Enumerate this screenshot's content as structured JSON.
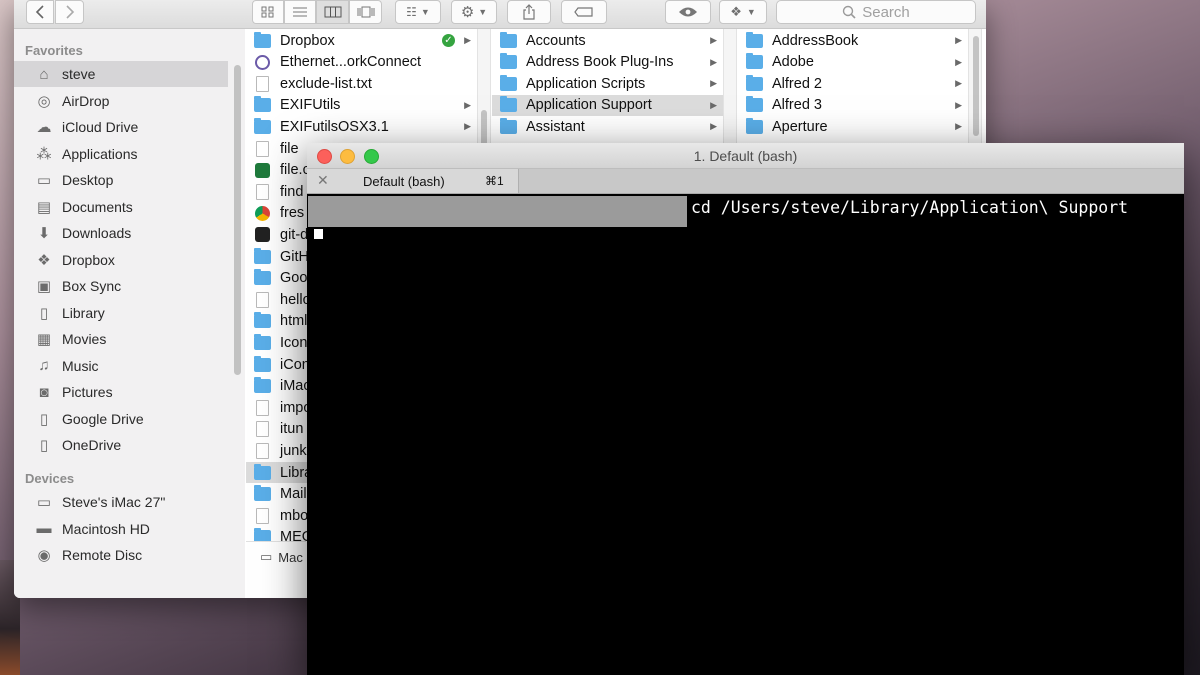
{
  "finder": {
    "search_placeholder": "Search",
    "sidebar": {
      "favorites_label": "Favorites",
      "favorites": [
        {
          "label": "steve",
          "icon": "home-icon",
          "selected": true
        },
        {
          "label": "AirDrop",
          "icon": "airdrop-icon"
        },
        {
          "label": "iCloud Drive",
          "icon": "cloud-icon"
        },
        {
          "label": "Applications",
          "icon": "applications-icon"
        },
        {
          "label": "Desktop",
          "icon": "desktop-icon"
        },
        {
          "label": "Documents",
          "icon": "documents-icon"
        },
        {
          "label": "Downloads",
          "icon": "downloads-icon"
        },
        {
          "label": "Dropbox",
          "icon": "dropbox-icon"
        },
        {
          "label": "Box Sync",
          "icon": "box-icon"
        },
        {
          "label": "Library",
          "icon": "folder-icon"
        },
        {
          "label": "Movies",
          "icon": "movies-icon"
        },
        {
          "label": "Music",
          "icon": "music-icon"
        },
        {
          "label": "Pictures",
          "icon": "camera-icon"
        },
        {
          "label": "Google Drive",
          "icon": "folder-icon"
        },
        {
          "label": "OneDrive",
          "icon": "folder-icon"
        }
      ],
      "devices_label": "Devices",
      "devices": [
        {
          "label": "Steve's iMac 27\"",
          "icon": "imac-icon"
        },
        {
          "label": "Macintosh HD",
          "icon": "harddisk-icon"
        },
        {
          "label": "Remote Disc",
          "icon": "disc-icon"
        }
      ]
    },
    "column1": [
      {
        "label": "Dropbox",
        "kind": "folder",
        "arrow": true
      },
      {
        "label": "Ethernet...orkConnect",
        "kind": "app"
      },
      {
        "label": "exclude-list.txt",
        "kind": "doc"
      },
      {
        "label": "EXIFUtils",
        "kind": "folder",
        "arrow": true
      },
      {
        "label": "EXIFutilsOSX3.1",
        "kind": "folder",
        "arrow": true
      },
      {
        "label": "file",
        "kind": "doc"
      },
      {
        "label": "file.c",
        "kind": "excel"
      },
      {
        "label": "find",
        "kind": "doc"
      },
      {
        "label": "fres",
        "kind": "chrome"
      },
      {
        "label": "git-d",
        "kind": "terminal"
      },
      {
        "label": "GitH",
        "kind": "folder"
      },
      {
        "label": "Goo",
        "kind": "folder"
      },
      {
        "label": "hello",
        "kind": "doc"
      },
      {
        "label": "html",
        "kind": "folder"
      },
      {
        "label": "Icon",
        "kind": "folder"
      },
      {
        "label": "iCon",
        "kind": "folder"
      },
      {
        "label": "iMac",
        "kind": "folder"
      },
      {
        "label": "impo",
        "kind": "doc"
      },
      {
        "label": "itun",
        "kind": "doc"
      },
      {
        "label": "junk",
        "kind": "doc"
      },
      {
        "label": "Libra",
        "kind": "folder",
        "selected": true
      },
      {
        "label": "Mail",
        "kind": "folder"
      },
      {
        "label": "mbo",
        "kind": "doc"
      },
      {
        "label": "MEG",
        "kind": "folder"
      }
    ],
    "column2": [
      {
        "label": "Accounts",
        "kind": "folder",
        "arrow": true
      },
      {
        "label": "Address Book Plug-Ins",
        "kind": "folder",
        "arrow": true
      },
      {
        "label": "Application Scripts",
        "kind": "folder",
        "arrow": true
      },
      {
        "label": "Application Support",
        "kind": "folder",
        "arrow": true,
        "selected": true
      },
      {
        "label": "Assistant",
        "kind": "folder",
        "arrow": true
      }
    ],
    "column3": [
      {
        "label": "AddressBook",
        "kind": "folder",
        "arrow": true
      },
      {
        "label": "Adobe",
        "kind": "folder",
        "arrow": true
      },
      {
        "label": "Alfred 2",
        "kind": "folder",
        "arrow": true
      },
      {
        "label": "Alfred 3",
        "kind": "folder",
        "arrow": true
      },
      {
        "label": "Aperture",
        "kind": "folder",
        "arrow": true
      }
    ],
    "pathbar_label": "Mac"
  },
  "terminal": {
    "window_title": "1. Default (bash)",
    "tab_label": "Default (bash)",
    "tab_shortcut": "⌘1",
    "command": "cd /Users/steve/Library/Application\\ Support"
  }
}
